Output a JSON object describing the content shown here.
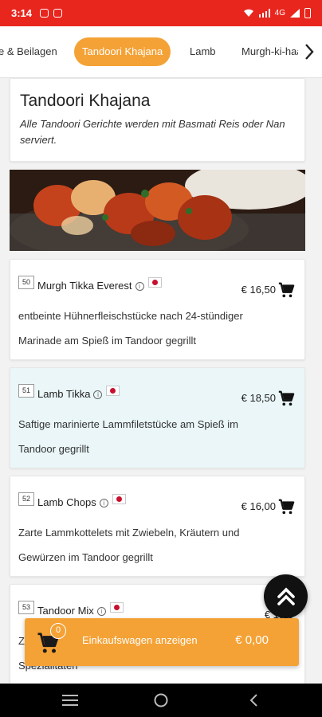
{
  "status_bar": {
    "time": "3:14",
    "network": "4G"
  },
  "tabs": [
    {
      "label": "e & Beilagen"
    },
    {
      "label": "Tandoori Khajana",
      "active": true
    },
    {
      "label": "Lamb"
    },
    {
      "label": "Murgh-ki-haa"
    }
  ],
  "section": {
    "title": "Tandoori Khajana",
    "description": "Alle Tandoori Gerichte werden mit Basmati Reis oder Nan serviert."
  },
  "dishes": [
    {
      "number": "50",
      "name": "Murgh Tikka Everest",
      "price": "€ 16,50",
      "description": "entbeinte Hühnerfleischstücke nach 24-stündiger Marinade am Spieß im Tandoor gegrillt"
    },
    {
      "number": "51",
      "name": "Lamb Tikka",
      "price": "€ 18,50",
      "description": "Saftige marinierte Lammfiletstücke am Spieß im Tandoor gegrillt"
    },
    {
      "number": "52",
      "name": "Lamb Chops",
      "price": "€ 16,00",
      "description": "Zarte Lammkottelets mit Zwiebeln, Kräutern und Gewürzen im Tandoor gegrillt"
    },
    {
      "number": "53",
      "name": "Tandoor Mix",
      "price": "€ 19,5",
      "description_partial": [
        "Z",
        "Spezialitäten"
      ]
    }
  ],
  "cart": {
    "count": "0",
    "label": "Einkaufswagen anzeigen",
    "total": "€ 0,00"
  },
  "icons": {
    "info": "info-icon",
    "flag": "flag-icon",
    "add_to_cart": "cart-icon",
    "scroll_top": "double-chevron-up-icon",
    "tabs_next": "chevron-right-icon"
  },
  "colors": {
    "status_bar": "#e8261d",
    "accent": "#f4a236",
    "highlight_row": "#eaf6f8"
  }
}
